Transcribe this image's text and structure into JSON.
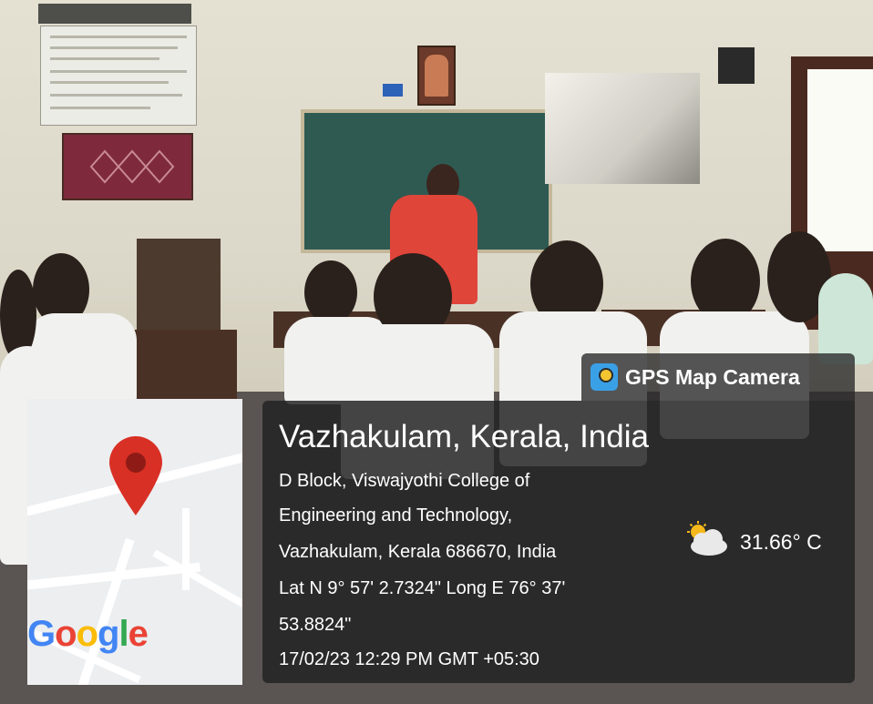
{
  "scene": {
    "description_icons": [
      "classroom-photo"
    ]
  },
  "app": {
    "badge_title": "GPS Map Camera",
    "badge_icon": "gps-map-camera-app-icon"
  },
  "location": {
    "place": "Vazhakulam, Kerala, India",
    "address_lines": [
      "D Block, Viswajyothi College of",
      "Engineering and Technology,",
      "Vazhakulam, Kerala 686670, India",
      "Lat N 9° 57' 2.7324\" Long E 76° 37'",
      "53.8824\"",
      "17/02/23 12:29 PM GMT +05:30"
    ]
  },
  "weather": {
    "icon": "partly-cloudy-icon",
    "temperature": "31.66° C"
  },
  "map": {
    "logo_text": "Google",
    "pin_icon": "map-pin-icon",
    "pin_color": "#d93025"
  }
}
